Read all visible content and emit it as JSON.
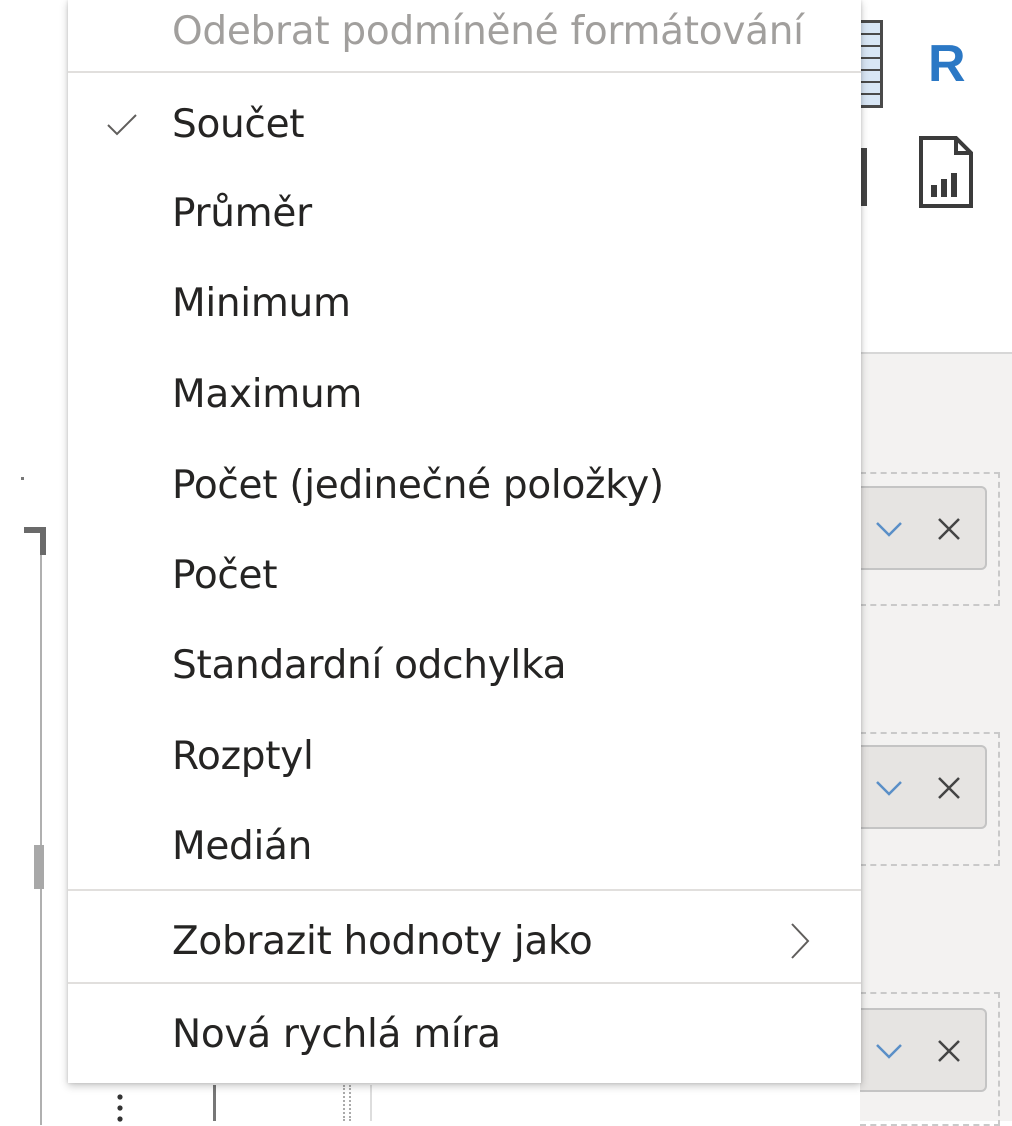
{
  "menu": {
    "top_item": {
      "label": "Odebrat podmíněné formátování",
      "disabled": true
    },
    "aggregations": [
      {
        "label": "Součet",
        "checked": true
      },
      {
        "label": "Průměr",
        "checked": false
      },
      {
        "label": "Minimum",
        "checked": false
      },
      {
        "label": "Maximum",
        "checked": false
      },
      {
        "label": "Počet (jedinečné položky)",
        "checked": false
      },
      {
        "label": "Počet",
        "checked": false
      },
      {
        "label": "Standardní odchylka",
        "checked": false
      },
      {
        "label": "Rozptyl",
        "checked": false
      },
      {
        "label": "Medián",
        "checked": false
      }
    ],
    "show_values_as": {
      "label": "Zobrazit hodnoty jako",
      "icon": "chevron-right-icon"
    },
    "quick_measure": {
      "label": "Nová rychlá míra"
    }
  },
  "background": {
    "ribbon_r_label": "R",
    "ribbon_r_color": "#2b78c5"
  }
}
